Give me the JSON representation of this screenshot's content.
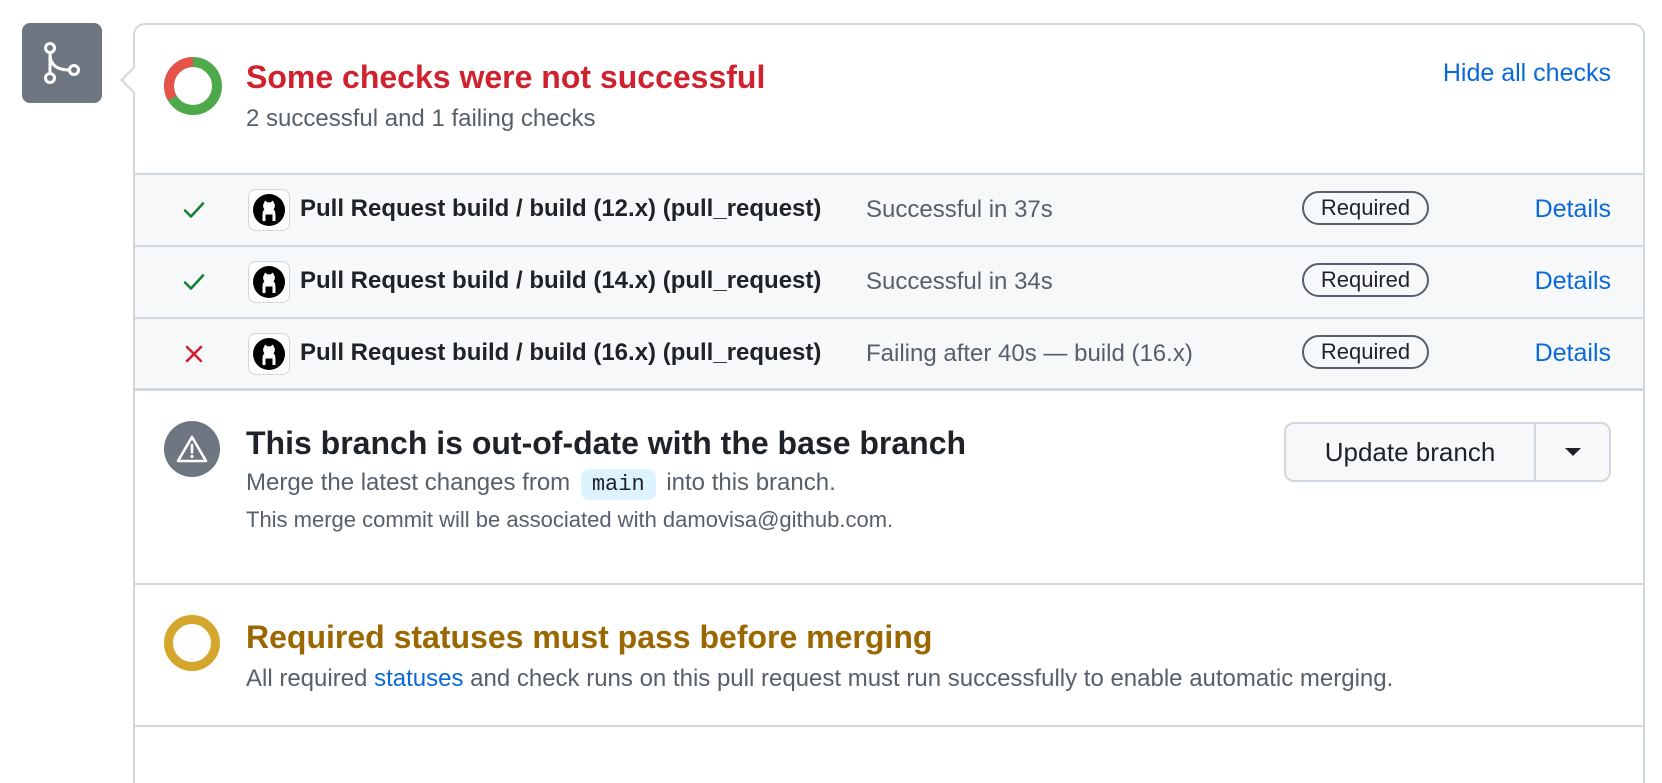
{
  "merge_panel": {
    "badge_icon": "git-merge-icon",
    "checks_header": {
      "title": "Some checks were not successful",
      "subtitle": "2 successful and 1 failing checks",
      "hide_link": "Hide all checks",
      "title_color": "#cf222e",
      "donut": {
        "successful": 2,
        "failing": 1,
        "success_color": "#4ea94a",
        "fail_color": "#e5534b"
      }
    },
    "checks": [
      {
        "status": "success",
        "status_icon": "check-icon",
        "app_icon": "github-icon",
        "name": "Pull Request build / build (12.x) (pull_request)",
        "description": "Successful in 37s",
        "badge": "Required",
        "link": "Details"
      },
      {
        "status": "success",
        "status_icon": "check-icon",
        "app_icon": "github-icon",
        "name": "Pull Request build / build (14.x) (pull_request)",
        "description": "Successful in 34s",
        "badge": "Required",
        "link": "Details"
      },
      {
        "status": "failure",
        "status_icon": "x-icon",
        "app_icon": "github-icon",
        "name": "Pull Request build / build (16.x) (pull_request)",
        "description": "Failing after 40s — build (16.x)",
        "badge": "Required",
        "link": "Details"
      }
    ],
    "branch": {
      "icon": "alert-icon",
      "title": "This branch is out-of-date with the base branch",
      "desc_before": "Merge the latest changes from",
      "branch_name": "main",
      "desc_after": "into this branch.",
      "note": "This merge commit will be associated with damovisa@github.com.",
      "update_button": "Update branch",
      "dropdown_icon": "triangle-down-icon"
    },
    "required": {
      "icon": "pending-circle-icon",
      "title": "Required statuses must pass before merging",
      "desc_before": "All required",
      "link": "statuses",
      "desc_after": "and check runs on this pull request must run successfully to enable automatic merging.",
      "title_color": "#9a6700"
    }
  }
}
